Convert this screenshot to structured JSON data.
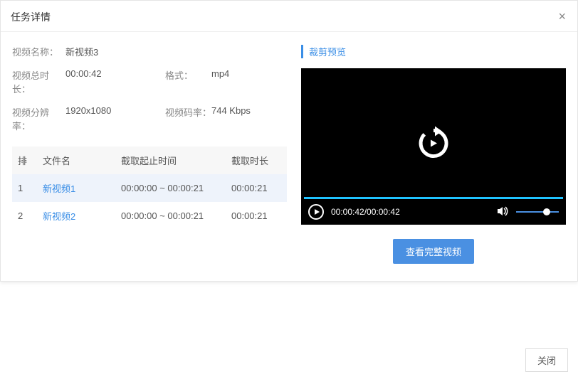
{
  "dialog": {
    "title": "任务详情",
    "close_x": "×"
  },
  "info": {
    "name_label": "视频名称：",
    "name_value": "新视频3",
    "duration_label": "视频总时长：",
    "duration_value": "00:00:42",
    "format_label": "格式：",
    "format_value": "mp4",
    "resolution_label": "视频分辨率：",
    "resolution_value": "1920x1080",
    "bitrate_label": "视频码率：",
    "bitrate_value": "744 Kbps"
  },
  "table": {
    "headers": {
      "rank": "排",
      "name": "文件名",
      "range": "截取起止时间",
      "duration": "截取时长"
    },
    "rows": [
      {
        "rank": "1",
        "name": "新视频1",
        "range": "00:00:00 ~ 00:00:21",
        "duration": "00:00:21",
        "selected": true
      },
      {
        "rank": "2",
        "name": "新视频2",
        "range": "00:00:00 ~ 00:00:21",
        "duration": "00:00:21",
        "selected": false
      }
    ]
  },
  "preview": {
    "title": "裁剪预览",
    "time": "00:00:42/00:00:42",
    "view_full_btn": "查看完整视频"
  },
  "footer": {
    "close_btn": "关闭"
  }
}
